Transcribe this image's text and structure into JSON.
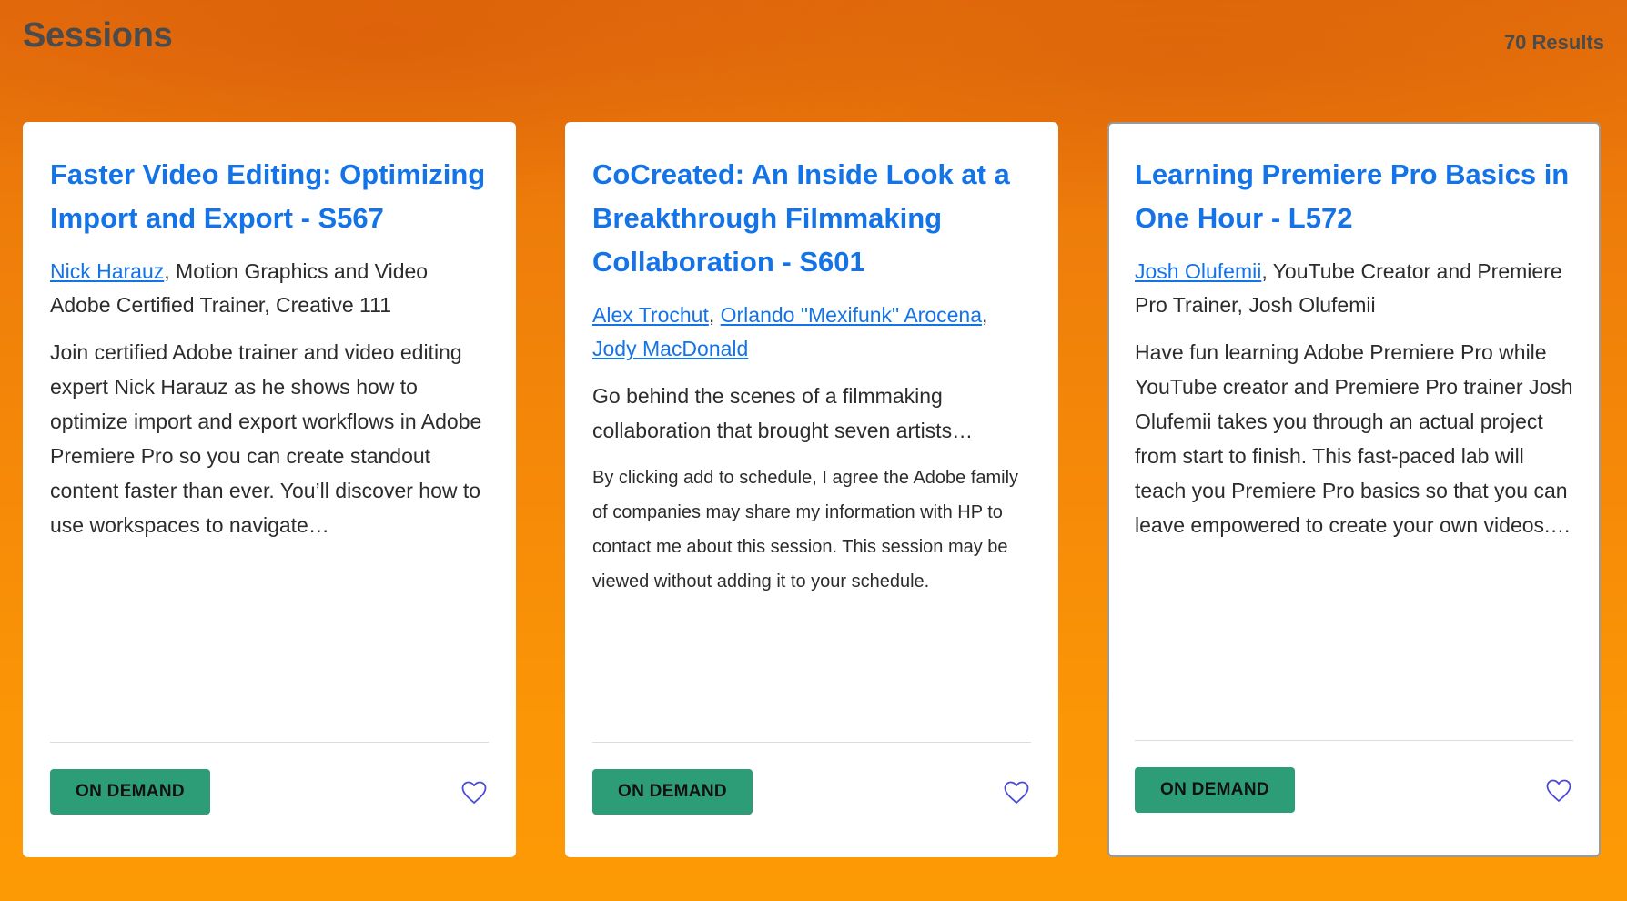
{
  "header": {
    "title": "Sessions",
    "results": "70 Results"
  },
  "icons": {
    "favorite": "heart-outline-icon"
  },
  "colors": {
    "link": "#1473e6",
    "badge": "#2d9d78",
    "heart": "#4a4ad8"
  },
  "cards": [
    {
      "title": "Faster Video Editing: Optimizing Import and Export - S567",
      "speakers": [
        {
          "name": "Nick Harauz"
        }
      ],
      "speaker_role": ", Motion Graphics and Video Adobe Certified Trainer, Creative 111",
      "description": "Join certified Adobe trainer and video editing expert Nick Harauz as he shows how to optimize import and export workflows in Adobe Premiere Pro so you can create standout content faster than ever. You’ll discover how to use workspaces to navigate…",
      "badge": "ON DEMAND"
    },
    {
      "title": "CoCreated: An Inside Look at a Breakthrough Filmmaking Collaboration - S601",
      "speakers": [
        {
          "name": "Alex Trochut"
        },
        {
          "name": "Orlando \"Mexifunk\" Arocena"
        },
        {
          "name": "Jody MacDonald"
        }
      ],
      "separator": ", ",
      "description": "Go behind the scenes of a filmmaking collaboration that brought seven artists…",
      "consent": "By clicking add to schedule, I agree the Adobe family of companies may share my information with HP to contact me about this session. This session may be viewed without adding it to your schedule.",
      "badge": "ON DEMAND"
    },
    {
      "title": "Learning Premiere Pro Basics in One Hour - L572",
      "speakers": [
        {
          "name": "Josh Olufemii"
        }
      ],
      "speaker_role": ", YouTube Creator and Premiere Pro Trainer, Josh Olufemii",
      "description": "Have fun learning Adobe Premiere Pro while YouTube creator and Premiere Pro trainer Josh Olufemii takes you through an actual project from start to finish. This fast-paced lab will teach you Premiere Pro basics so that you can leave empowered to create your own videos.…",
      "badge": "ON DEMAND"
    }
  ]
}
